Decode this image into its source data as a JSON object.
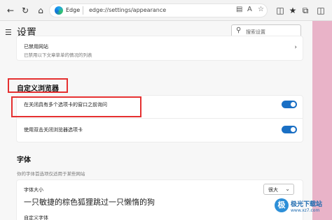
{
  "browser": {
    "brand": "Edge",
    "url": "edge://settings/appearance",
    "icons": {
      "back": "back-arrow-icon",
      "refresh": "refresh-icon",
      "home": "home-icon",
      "reader": "reader-mode-icon",
      "favorite": "favorite-star-icon",
      "split": "split-screen-icon",
      "collections": "collections-icon",
      "tab_actions": "tab-actions-icon",
      "extensions": "extensions-icon"
    }
  },
  "settings": {
    "title": "设置",
    "search_placeholder": "搜索设置"
  },
  "blocked_sites": {
    "title": "已禁用网站",
    "description": "已禁用以下文章草单的情况的列表"
  },
  "customize_browser": {
    "heading": "自定义浏览器",
    "items": [
      {
        "label": "在关闭具有多个选项卡的窗口之前询问",
        "enabled": true
      },
      {
        "label": "使用双击关闭浏览器选项卡",
        "enabled": true
      }
    ]
  },
  "fonts": {
    "heading": "字体",
    "subheading": "你的字体首选项仅适用于某些网站",
    "size_label": "字体大小",
    "size_value": "很大",
    "preview_text": "一只敏捷的棕色狐狸跳过一只懒惰的狗",
    "custom_label": "自定义字体"
  },
  "watermark": {
    "logo_letter": "极",
    "title": "极光下载站",
    "subtitle": "www.xz7.com"
  },
  "colors": {
    "toggle_on": "#1a6fc4",
    "highlight_box": "#e53030",
    "background_pink": "#e9b3c8"
  }
}
